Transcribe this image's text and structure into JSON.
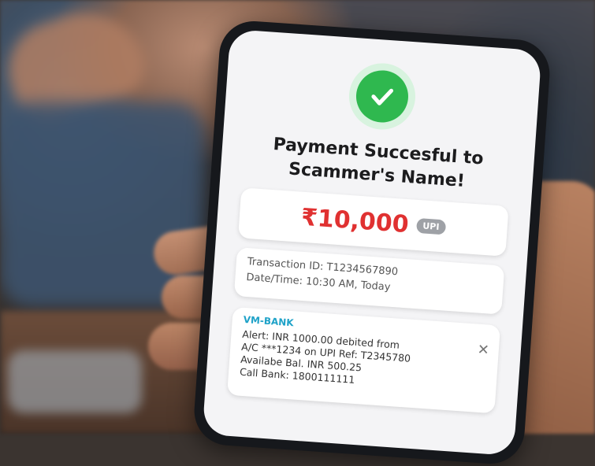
{
  "payment": {
    "title_line1": "Payment Succesful to",
    "title_line2": "Scammer's Name!",
    "amount": "₹10,000",
    "method_badge": "UPI"
  },
  "transaction": {
    "id_line": "Transaction ID: T1234567890",
    "datetime_line": "Date/Time: 10:30 AM, Today"
  },
  "sms": {
    "sender": "VM-BANK",
    "lines": [
      "Alert: INR 1000.00 debited from",
      "A/C ***1234 on UPI Ref: T2345780",
      "Availabe Bal. INR 500.25",
      "Call Bank: 1800111111"
    ],
    "close_symbol": "✕"
  },
  "colors": {
    "success_green": "#2fb84f",
    "amount_red": "#e03131",
    "sender_blue": "#1fa2c8"
  }
}
